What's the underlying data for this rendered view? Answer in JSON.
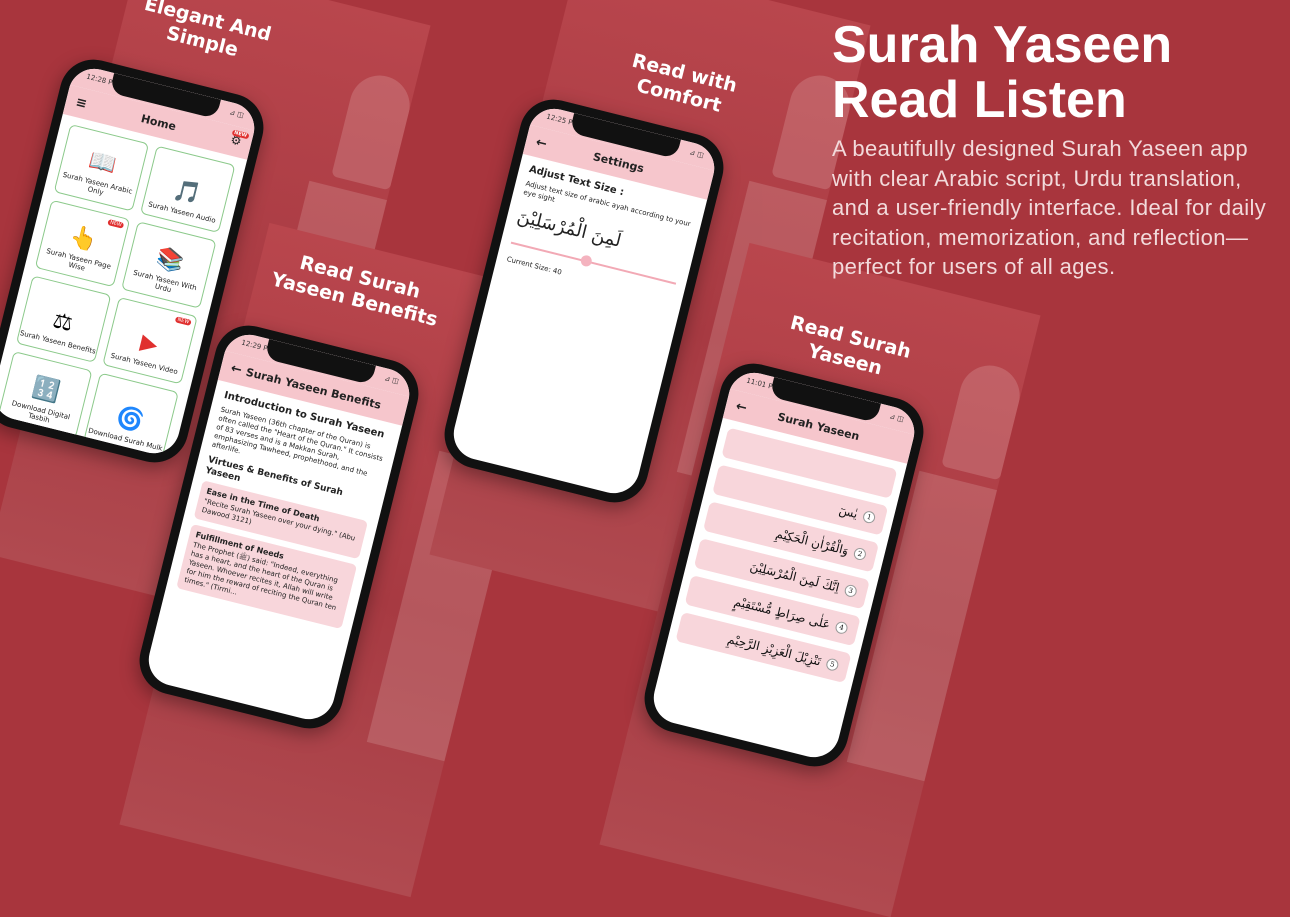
{
  "headline": {
    "line1": "Surah Yaseen",
    "line2": "Read Listen"
  },
  "description": "A beautifully designed Surah Yaseen app with clear Arabic script, Urdu translation, and a user-friendly interface. Ideal for daily recitation, memorization, and reflection—perfect for users of all ages.",
  "screen1": {
    "caption_line1": "Elegant And",
    "caption_line2": "Simple",
    "time": "12:28 PM",
    "status_icons": "⊿ ◫",
    "menu_icon": "≡",
    "title": "Home",
    "settings_icon": "⚙",
    "badge": "NEW",
    "cards": [
      {
        "label": "Surah Yaseen Arabic Only",
        "icon": "📖",
        "badge": ""
      },
      {
        "label": "Surah Yaseen Audio",
        "icon": "🎵",
        "badge": ""
      },
      {
        "label": "Surah Yaseen Page Wise",
        "icon": "👆",
        "badge": "NEW"
      },
      {
        "label": "Surah Yaseen With Urdu",
        "icon": "📚",
        "badge": ""
      },
      {
        "label": "Surah Yaseen Benefits",
        "icon": "⚖",
        "badge": ""
      },
      {
        "label": "Surah Yaseen Video",
        "icon": "▶",
        "badge": "NEW"
      },
      {
        "label": "Download Digital Tasbih",
        "icon": "🔢",
        "badge": ""
      },
      {
        "label": "Download Surah Mulk",
        "icon": "🌀",
        "badge": ""
      }
    ]
  },
  "screen2": {
    "caption_line1": "Read Surah",
    "caption_line2": "Yaseen Benefits",
    "time": "12:29 PM",
    "back_icon": "←",
    "title": "Surah Yaseen Benefits",
    "intro_heading": "Introduction to Surah Yaseen",
    "intro_text": "Surah Yaseen (36th chapter of the Quran) is often called the \"Heart of the Quran.\" It consists of 83 verses and is a Makkan Surah, emphasizing Tawheed, prophethood, and the afterlife.",
    "virtues_heading": "Virtues & Benefits of Surah Yaseen",
    "benefits": [
      {
        "title": "Ease in the Time of Death",
        "text": "\"Recite Surah Yaseen over your dying.\" (Abu Dawood 3121)"
      },
      {
        "title": "Fulfillment of Needs",
        "text": "The Prophet (ﷺ) said: \"Indeed, everything has a heart, and the heart of the Quran is Yaseen. Whoever recites it, Allah will write for him the reward of reciting the Quran ten times.\" (Tirmi..."
      }
    ]
  },
  "screen3": {
    "caption_line1": "Read with",
    "caption_line2": "Comfort",
    "time": "12:25 PM",
    "back_icon": "←",
    "title": "Settings",
    "heading": "Adjust Text Size :",
    "subtext": "Adjust text size of arabic ayah according to your eye sight",
    "arabic_sample": "لَمِنَ الْمُرْسَلِيْنَ",
    "slider_value": 0.45,
    "current_size": "Current Size: 40"
  },
  "screen4": {
    "caption_line1": "Read Surah",
    "caption_line2": "Yaseen",
    "time": "11:01 PM",
    "back_icon": "←",
    "title": "Surah Yaseen",
    "ayahs": [
      {
        "num": "",
        "text": ""
      },
      {
        "num": "1",
        "text": "يٰسٓ"
      },
      {
        "num": "2",
        "text": "وَالْقُرْاٰنِ الْحَكِيْمِ"
      },
      {
        "num": "3",
        "text": "اِنَّكَ لَمِنَ الْمُرْسَلِيْنَ"
      },
      {
        "num": "4",
        "text": "عَلٰى صِرَاطٍ مُّسْتَقِيْمٍ"
      },
      {
        "num": "5",
        "text": "تَنْزِيْلَ الْعَزِيْزِ الرَّحِيْمِ"
      }
    ]
  }
}
